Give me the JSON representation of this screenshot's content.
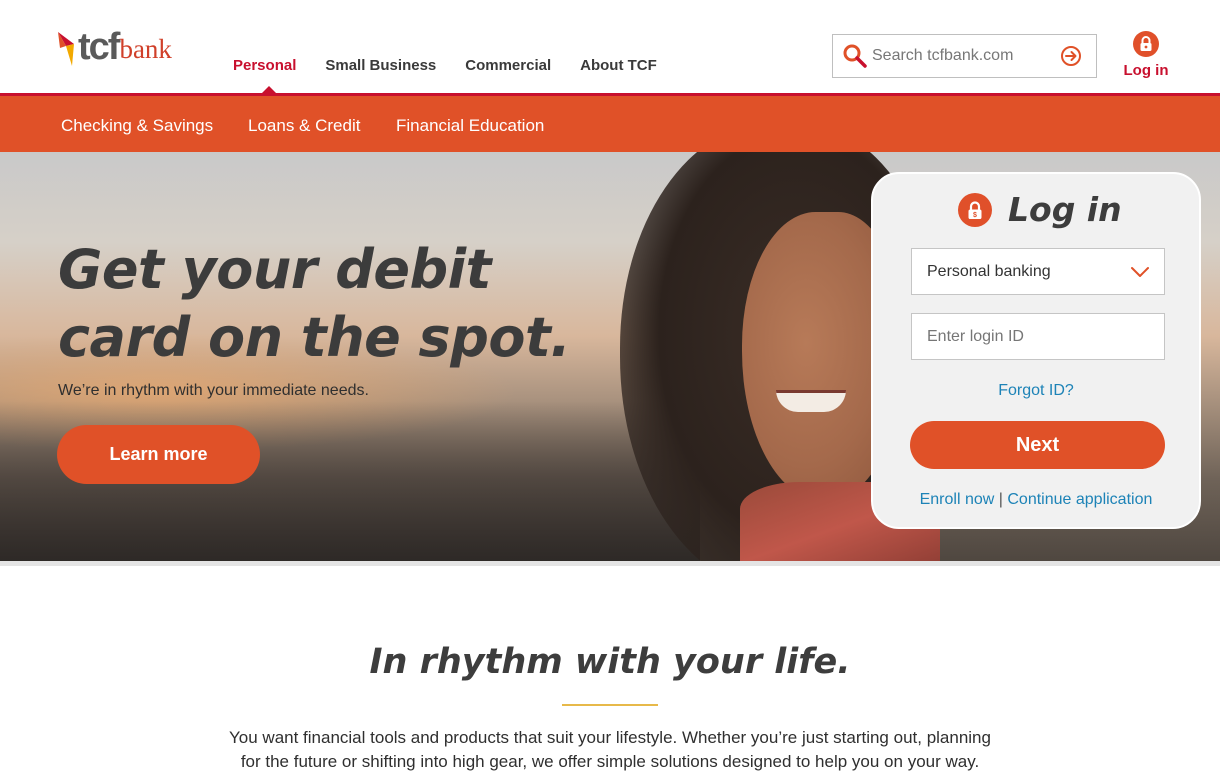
{
  "brand": {
    "logo_tcf": "tcf",
    "logo_bank": "bank",
    "accent": "#e05128",
    "brand_red": "#c8102e",
    "link_blue": "#1d83b7"
  },
  "header": {
    "nav": [
      {
        "label": "Personal",
        "active": true
      },
      {
        "label": "Small Business",
        "active": false
      },
      {
        "label": "Commercial",
        "active": false
      },
      {
        "label": "About TCF",
        "active": false
      }
    ],
    "search_placeholder": "Search tcfbank.com",
    "search_icon": "search-icon",
    "search_go_icon": "arrow-circle-right-icon",
    "login_label": "Log in",
    "login_icon": "lock-icon"
  },
  "subnav": {
    "items": [
      {
        "label": "Checking & Savings"
      },
      {
        "label": "Loans & Credit"
      },
      {
        "label": "Financial Education"
      }
    ]
  },
  "hero": {
    "title_line1": "Get your debit",
    "title_line2": "card on the spot.",
    "subtitle": "We’re in rhythm with your immediate needs.",
    "cta_label": "Learn more"
  },
  "login_card": {
    "title": "Log in",
    "account_type_selected": "Personal banking",
    "login_id_placeholder": "Enter login ID",
    "forgot_label": "Forgot ID?",
    "next_label": "Next",
    "enroll_label": "Enroll now",
    "separator": "|",
    "continue_label": "Continue application"
  },
  "section": {
    "tagline": "In rhythm with your life.",
    "intro_line1": "You want financial tools and products that suit your lifestyle. Whether you’re just starting out, planning",
    "intro_line2": "for the future or shifting into high gear, we offer simple solutions designed to help you on your way."
  }
}
